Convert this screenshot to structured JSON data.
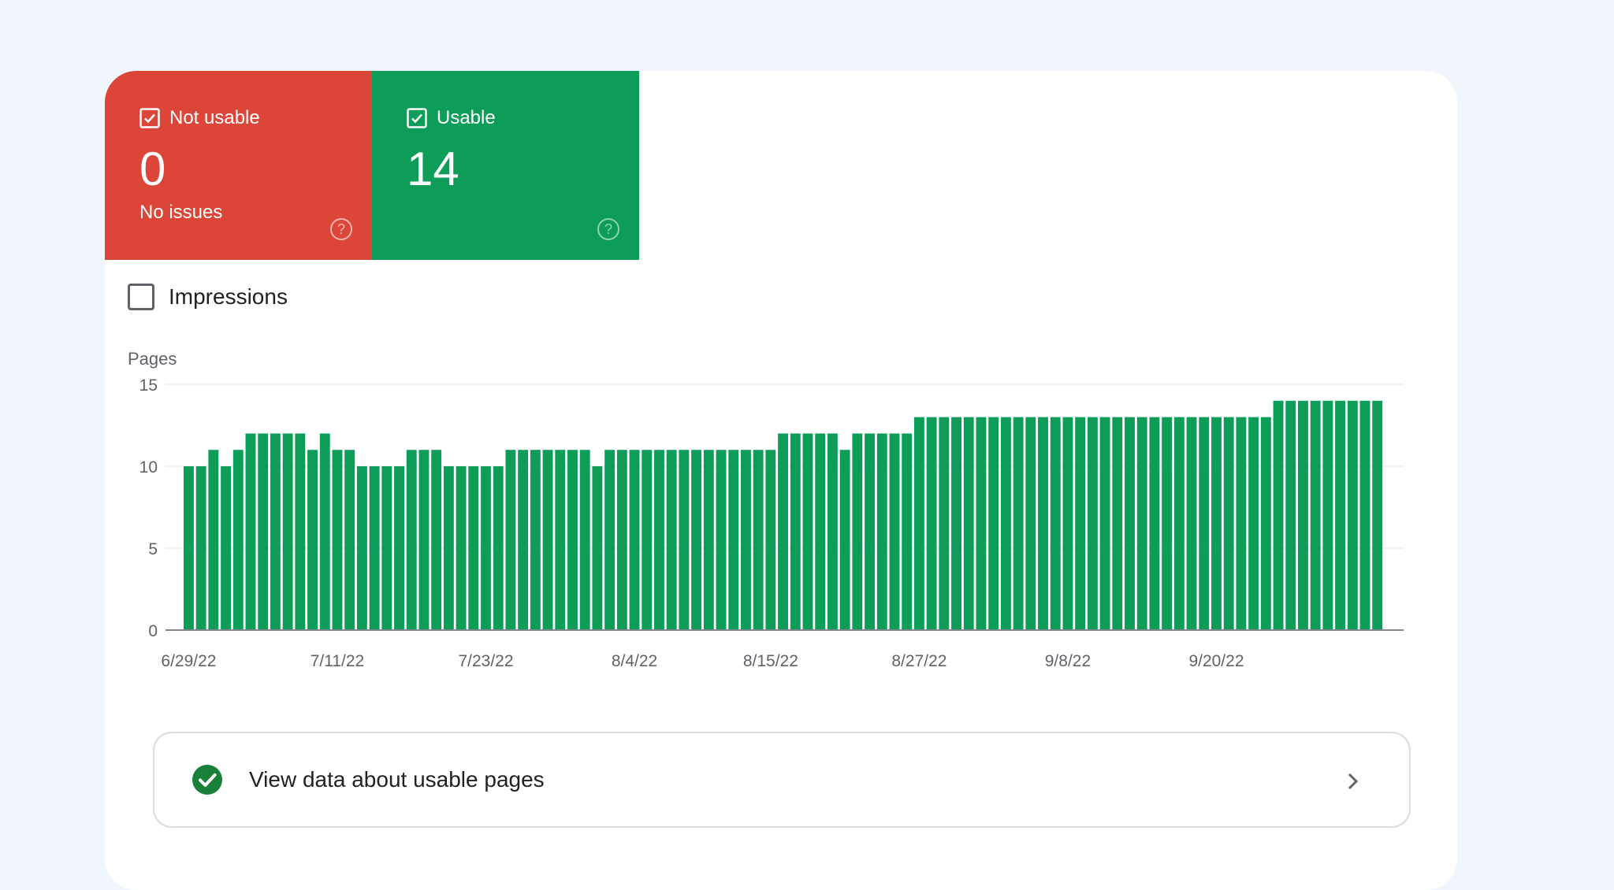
{
  "tiles": [
    {
      "label": "Not usable",
      "count": "0",
      "sub": "No issues",
      "color": "#dc4639"
    },
    {
      "label": "Usable",
      "count": "14",
      "sub": "",
      "color": "#0d9d58"
    }
  ],
  "impressions": {
    "label": "Impressions",
    "checked": false
  },
  "cta": {
    "label": "View data about usable pages"
  },
  "chart_data": {
    "type": "bar",
    "ylabel": "Pages",
    "ylim": [
      0,
      15
    ],
    "yticks": [
      0,
      5,
      10,
      15
    ],
    "xtick_labels": [
      "6/29/22",
      "7/11/22",
      "7/23/22",
      "8/4/22",
      "8/15/22",
      "8/27/22",
      "9/8/22",
      "9/20/22"
    ],
    "bar_color": "#0d9d58",
    "values": [
      10,
      10,
      11,
      10,
      11,
      12,
      12,
      12,
      12,
      12,
      11,
      12,
      11,
      11,
      10,
      10,
      10,
      10,
      11,
      11,
      11,
      10,
      10,
      10,
      10,
      10,
      11,
      11,
      11,
      11,
      11,
      11,
      11,
      10,
      11,
      11,
      11,
      11,
      11,
      11,
      11,
      11,
      11,
      11,
      11,
      11,
      11,
      11,
      12,
      12,
      12,
      12,
      12,
      11,
      12,
      12,
      12,
      12,
      12,
      13,
      13,
      13,
      13,
      13,
      13,
      13,
      13,
      13,
      13,
      13,
      13,
      13,
      13,
      13,
      13,
      13,
      13,
      13,
      13,
      13,
      13,
      13,
      13,
      13,
      13,
      13,
      13,
      13,
      14,
      14,
      14,
      14,
      14,
      14,
      14,
      14,
      14
    ]
  }
}
